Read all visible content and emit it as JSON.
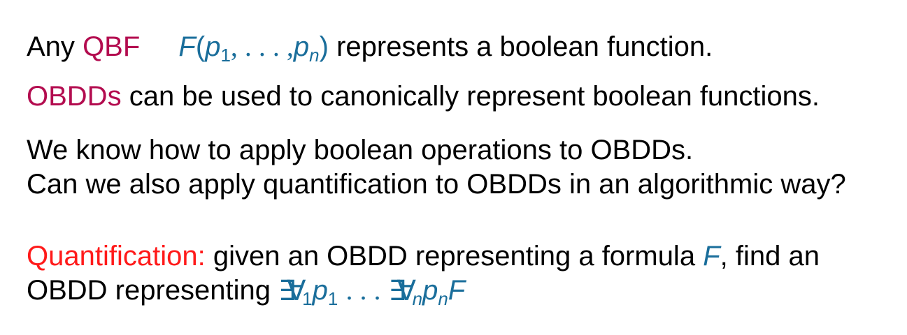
{
  "line1": {
    "prefix": "Any",
    "qbf": "QBF",
    "formula_F": "F",
    "open_paren": "(",
    "p": "p",
    "sub1": "1",
    "comma_dots": ", . . . ,",
    "pn": "p",
    "subn": "n",
    "close_paren": ")",
    "suffix": "represents a boolean function."
  },
  "line2": {
    "obdds": "OBDDs",
    "rest": "can be used to canonically represent boolean functions."
  },
  "line3": {
    "text": "We know how to apply boolean operations to OBDDs."
  },
  "line4": {
    "text": "Can we also apply quantification to OBDDs in an algorithmic way?"
  },
  "line5": {
    "label": "Quantification:",
    "middle": "given an OBDD representing a formula",
    "F": "F",
    "end": ", find an"
  },
  "line6": {
    "start": "OBDD representing",
    "exists": "∃",
    "forall": "∀",
    "sub1": "1",
    "p": "p",
    "p_sub1": "1",
    "dots": ". . .",
    "subn": "n",
    "pn_sub": "n",
    "F": "F"
  },
  "colors": {
    "magenta": "#b30c4f",
    "red": "#ff1a1a",
    "blue": "#1a6e9b"
  }
}
